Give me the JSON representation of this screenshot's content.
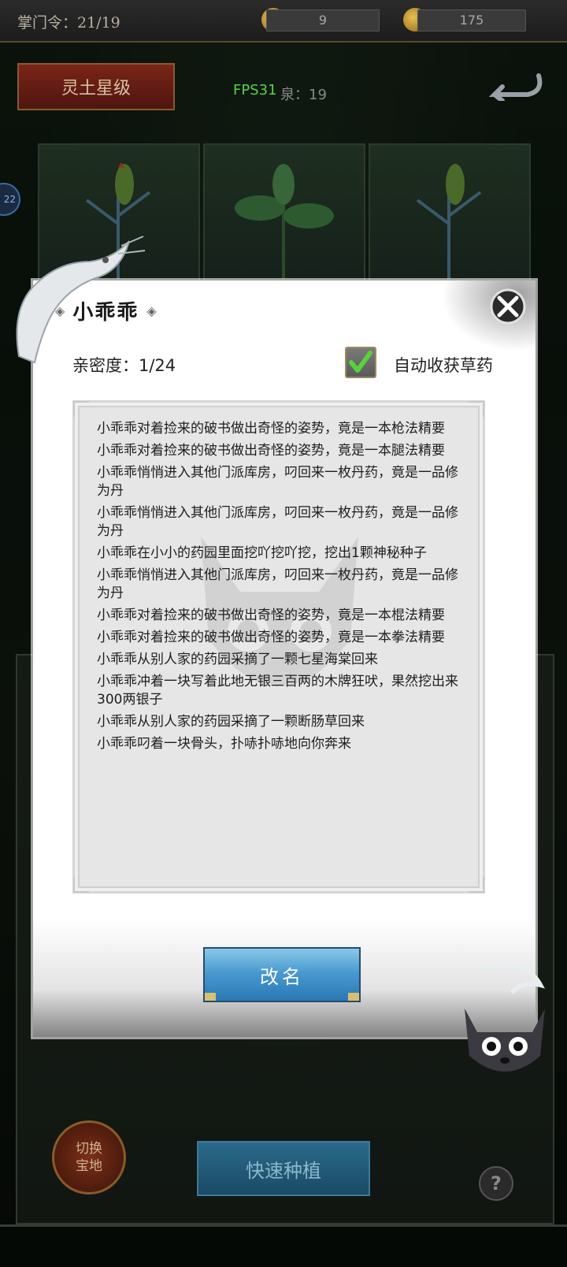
{
  "topbar": {
    "token_label": "掌门令：21/19",
    "res1_value": "9",
    "res2_value": "175"
  },
  "scene": {
    "star_button": "灵土星级",
    "fps": "FPS31",
    "spring": "泉：19",
    "side_badge": "22",
    "switch_button": "切换\n宝地",
    "quick_plant_button": "快速种植",
    "help_button": "?"
  },
  "modal": {
    "title": "小乖乖",
    "intimacy": "亲密度：1/24",
    "auto_harvest_label": "自动收获草药",
    "auto_harvest_checked": true,
    "logs": [
      "小乖乖对着捡来的破书做出奇怪的姿势，竟是一本枪法精要",
      "小乖乖对着捡来的破书做出奇怪的姿势，竟是一本腿法精要",
      "小乖乖悄悄进入其他门派库房，叼回来一枚丹药，竟是一品修为丹",
      "小乖乖悄悄进入其他门派库房，叼回来一枚丹药，竟是一品修为丹",
      "小乖乖在小小的药园里面挖吖挖吖挖，挖出1颗神秘种子",
      "小乖乖悄悄进入其他门派库房，叼回来一枚丹药，竟是一品修为丹",
      "小乖乖对着捡来的破书做出奇怪的姿势，竟是一本棍法精要",
      "小乖乖对着捡来的破书做出奇怪的姿势，竟是一本拳法精要",
      "小乖乖从别人家的药园采摘了一颗七星海棠回来",
      "小乖乖冲着一块写着此地无银三百两的木牌狂吠，果然挖出来300两银子",
      "小乖乖从别人家的药园采摘了一颗断肠草回来",
      "小乖乖叼着一块骨头，扑哧扑哧地向你奔来"
    ],
    "rename_button": "改名"
  },
  "colors": {
    "check_green": "#5ad03a",
    "fps_green": "#5ad04a",
    "button_blue": "#4a9ad0",
    "star_red": "#7a2418"
  },
  "icons": {
    "close": "close-x-icon",
    "check": "checkmark-icon",
    "back": "back-arrow-icon",
    "resource1": "gold-ingot-icon",
    "resource2": "treasure-icon"
  }
}
